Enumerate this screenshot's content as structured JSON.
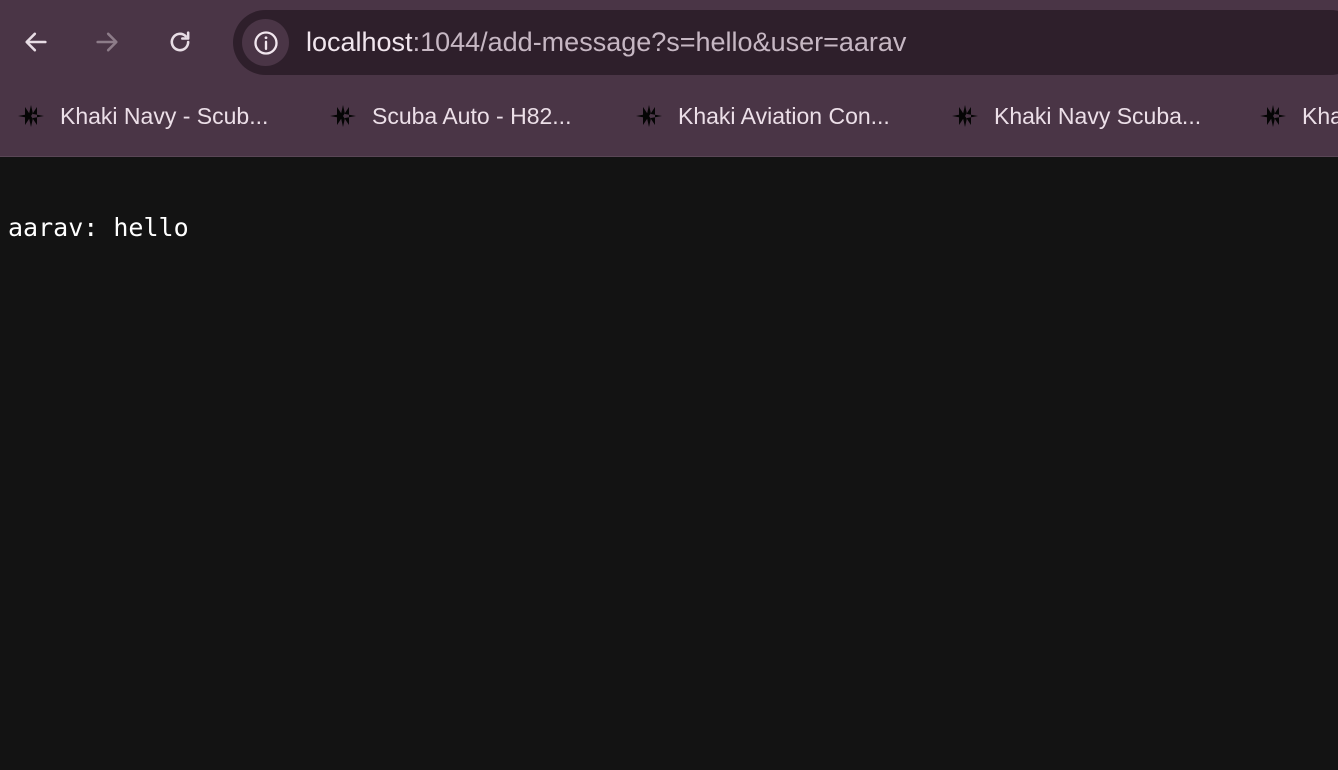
{
  "browser": {
    "url_host": "localhost",
    "url_rest": ":1044/add-message?s=hello&user=aarav",
    "nav": {
      "back_icon": "arrow-left-icon",
      "forward_icon": "arrow-right-icon",
      "reload_icon": "reload-icon",
      "site_info_icon": "info-circle-icon"
    },
    "bookmarks": [
      {
        "label": "Khaki Navy - Scub...",
        "icon": "star-logo-icon"
      },
      {
        "label": "Scuba Auto - H82...",
        "icon": "star-logo-icon"
      },
      {
        "label": "Khaki Aviation Con...",
        "icon": "star-logo-icon"
      },
      {
        "label": "Khaki Navy Scuba...",
        "icon": "star-logo-icon"
      },
      {
        "label": "Kha",
        "icon": "star-logo-icon"
      }
    ]
  },
  "page": {
    "message": "aarav: hello"
  },
  "colors": {
    "chrome_bg": "#4a3546",
    "omnibox_bg": "#2e1f2b",
    "page_bg": "#131313",
    "text": "#ffffff"
  }
}
